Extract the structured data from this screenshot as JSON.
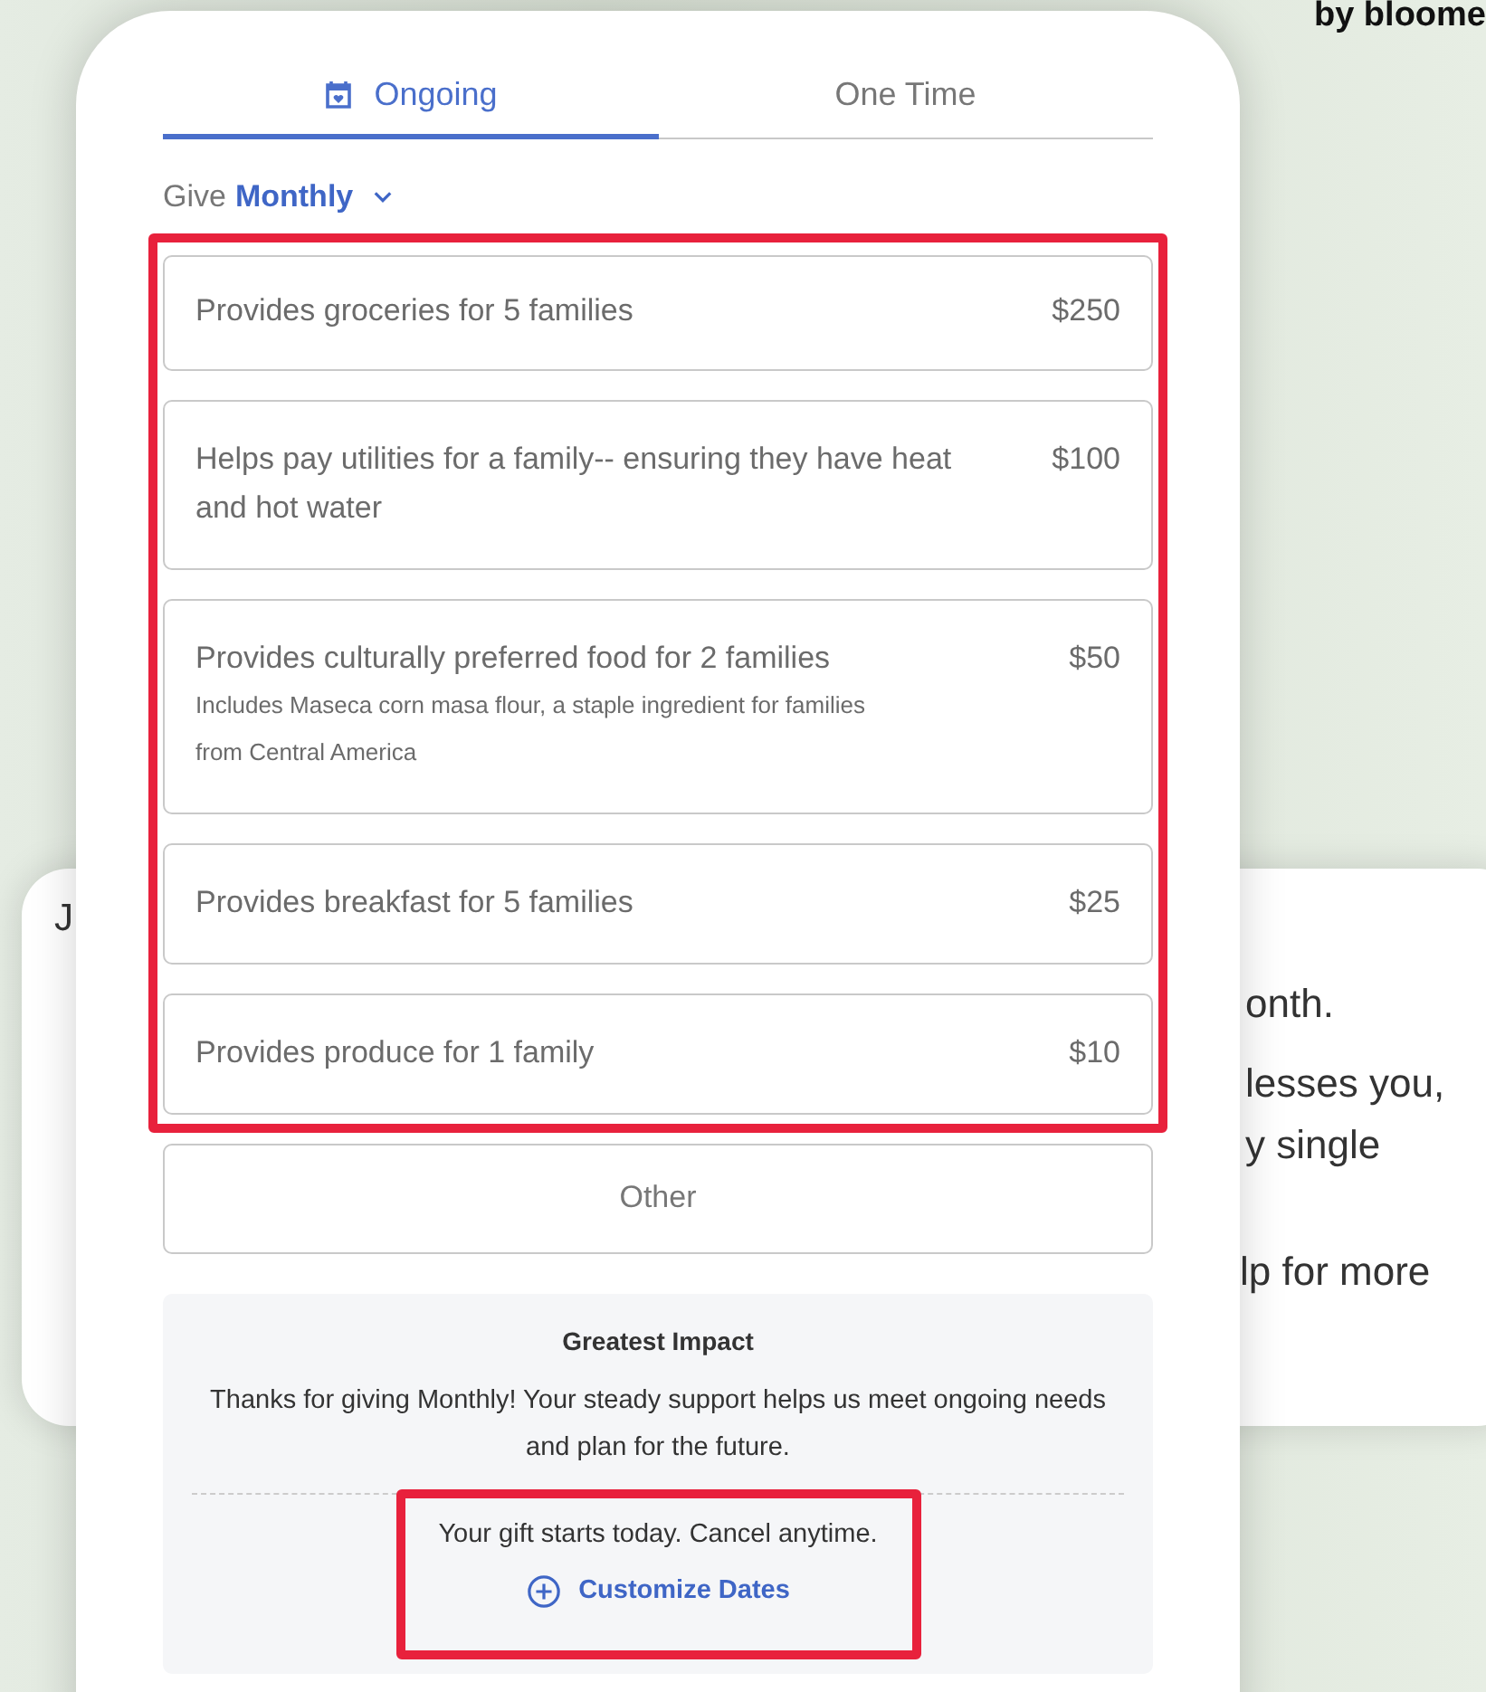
{
  "brand": "by bloome",
  "background_card": {
    "left_text": "J",
    "lines": [
      "onth.",
      "lesses you,",
      "y single",
      "lp for more"
    ]
  },
  "tabs": [
    {
      "label": "Ongoing",
      "selected": true,
      "icon": true
    },
    {
      "label": "One Time",
      "selected": false,
      "icon": false
    }
  ],
  "frequency": {
    "label": "Give",
    "value": "Monthly"
  },
  "options": [
    {
      "title": "Provides groceries for 5 families",
      "amount": "$250"
    },
    {
      "title": "Helps pay utilities for a family-- ensuring they have heat and hot water",
      "amount": "$100"
    },
    {
      "title": "Provides culturally preferred food for 2 families",
      "amount": "$50",
      "note": "Includes Maseca corn masa flour, a staple ingredient for families from Central America"
    },
    {
      "title": "Provides breakfast for 5 families",
      "amount": "$25"
    },
    {
      "title": "Provides produce for 1 family",
      "amount": "$10"
    }
  ],
  "other_button": "Other",
  "impact": {
    "title": "Greatest Impact",
    "message": "Thanks for giving Monthly! Your steady support helps us meet ongoing needs and plan for the future.",
    "start_note": "Your gift starts today. Cancel anytime.",
    "link": "Customize Dates"
  }
}
